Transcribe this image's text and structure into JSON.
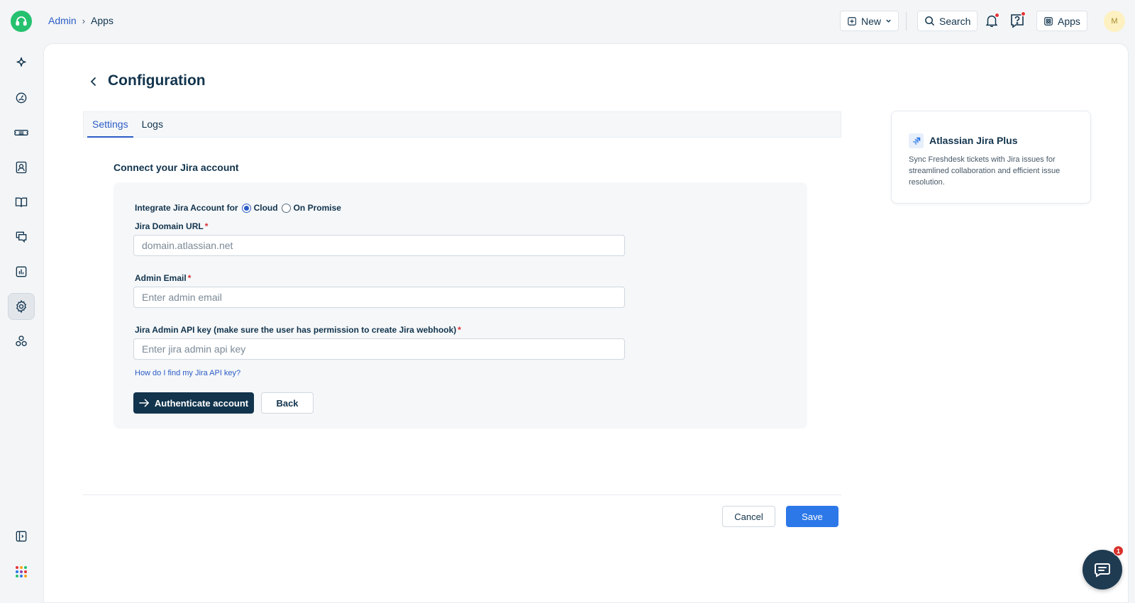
{
  "breadcrumb": {
    "admin": "Admin",
    "separator": "›",
    "current": "Apps"
  },
  "topbar": {
    "new_label": "New",
    "search_label": "Search",
    "apps_label": "Apps",
    "avatar_initial": "M"
  },
  "icons": {
    "logo": "headset-icon",
    "sidebar": [
      "sparkle-icon",
      "dashboard-icon",
      "ticket-icon",
      "contacts-icon",
      "book-icon",
      "chat-icon",
      "reports-icon",
      "gear-icon",
      "groups-icon",
      "expand-sidebar-icon",
      "app-launcher-icon"
    ],
    "notifications": "bell-icon",
    "help": "help-icon"
  },
  "page": {
    "title": "Configuration",
    "tabs": [
      {
        "label": "Settings",
        "active": true
      },
      {
        "label": "Logs",
        "active": false
      }
    ]
  },
  "form": {
    "section_title": "Connect your Jira account",
    "integrate_label": "Integrate Jira Account for",
    "options": [
      {
        "label": "Cloud",
        "checked": true
      },
      {
        "label": "On Promise",
        "checked": false
      }
    ],
    "domain": {
      "label": "Jira Domain URL",
      "value": "",
      "placeholder": "domain.atlassian.net"
    },
    "email": {
      "label": "Admin Email",
      "value": "",
      "placeholder": "Enter admin email"
    },
    "api_key": {
      "label": "Jira Admin API key (make sure the user has permission to create Jira webhook)",
      "value": "",
      "placeholder": "Enter jira admin api key"
    },
    "required_mark": "*",
    "help_link": "How do I find my Jira API key?",
    "authenticate_label": "Authenticate account",
    "back_label": "Back"
  },
  "footer": {
    "cancel_label": "Cancel",
    "save_label": "Save"
  },
  "app_card": {
    "name": "Atlassian Jira Plus",
    "description": "Sync Freshdesk tickets with Jira issues for streamlined collaboration and efficient issue resolution."
  },
  "chat": {
    "badge_count": "1"
  },
  "colors": {
    "primary": "#2c5cc5",
    "save": "#2c78e8",
    "dark": "#12344d",
    "brand_green": "#25c16f",
    "alert": "#e43538"
  }
}
